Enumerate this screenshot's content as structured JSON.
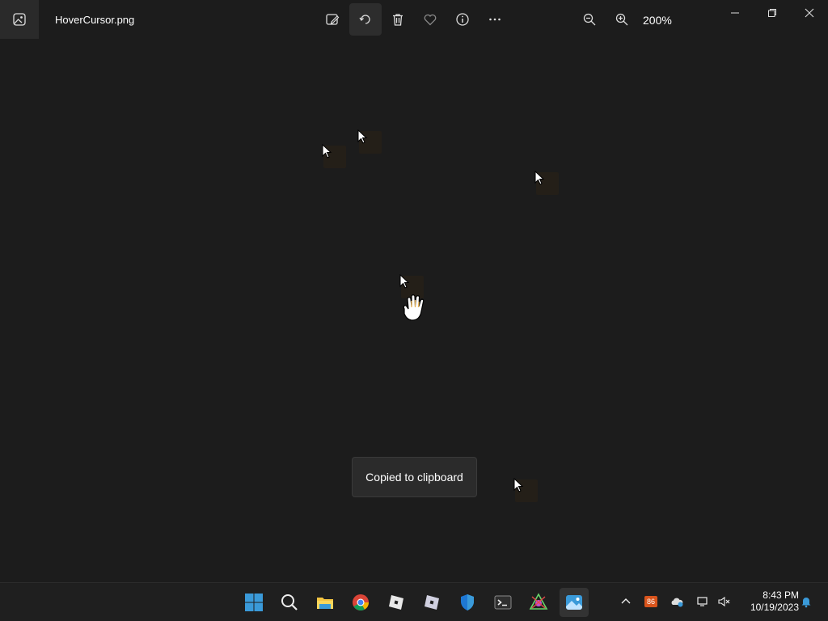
{
  "titlebar": {
    "filename": "HoverCursor.png",
    "zoom_label": "200%",
    "toolbar": [
      {
        "name": "edit-image-icon",
        "tooltip": "Edit image"
      },
      {
        "name": "rotate-icon",
        "tooltip": "Rotate"
      },
      {
        "name": "delete-icon",
        "tooltip": "Delete"
      },
      {
        "name": "favorite-icon",
        "tooltip": "Add to favorites"
      },
      {
        "name": "info-icon",
        "tooltip": "File information"
      },
      {
        "name": "more-icon",
        "tooltip": "See more"
      }
    ],
    "zoom_controls": [
      {
        "name": "zoom-out-icon"
      },
      {
        "name": "zoom-in-icon"
      }
    ],
    "window_controls": [
      "minimize-icon",
      "restore-icon",
      "close-icon"
    ]
  },
  "toast": {
    "message": "Copied to clipboard"
  },
  "taskbar": {
    "apps": [
      "windows-start-icon",
      "search-icon",
      "file-explorer-icon",
      "chrome-icon",
      "roblox-icon",
      "roblox-studio-icon",
      "windows-security-icon",
      "terminal-icon",
      "color-app-icon",
      "photos-icon"
    ],
    "tray": {
      "notification_badge": "86",
      "icons": [
        "chevron-up-icon",
        "onedrive-icon",
        "network-icon",
        "speaker-muted-icon",
        "notification-bell-icon"
      ]
    },
    "clock": {
      "time": "8:43 PM",
      "date": "10/19/2023"
    }
  },
  "colors": {
    "background": "#1c1c1c",
    "taskbar": "#1f1f1f",
    "toast": "#2b2b2b",
    "accent": "#3a9ad9"
  }
}
